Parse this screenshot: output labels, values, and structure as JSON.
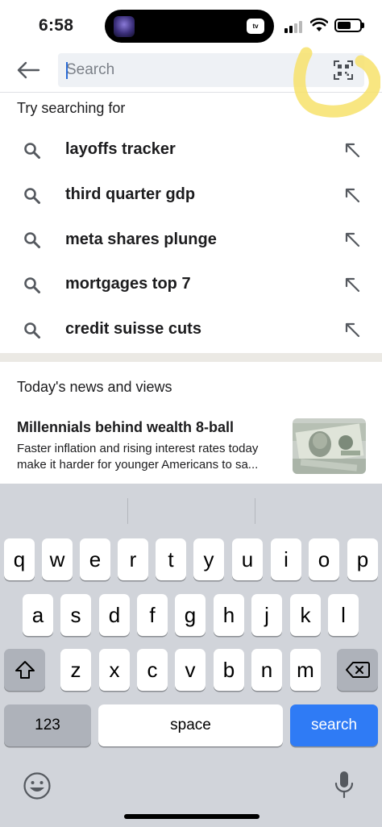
{
  "status_bar": {
    "time": "6:58",
    "island_badge": "tv"
  },
  "search": {
    "placeholder": "Search",
    "value": ""
  },
  "suggestions_title": "Try searching for",
  "suggestions": [
    {
      "label": "layoffs tracker"
    },
    {
      "label": "third quarter gdp"
    },
    {
      "label": "meta shares plunge"
    },
    {
      "label": "mortgages top 7"
    },
    {
      "label": "credit suisse cuts"
    }
  ],
  "news_title": "Today's news and views",
  "news": [
    {
      "headline": "Millennials behind wealth 8-ball",
      "summary_line1": "Faster inflation and rising interest rates today",
      "summary_line2": "make it harder for younger Americans to sa..."
    }
  ],
  "keyboard": {
    "row1": [
      "q",
      "w",
      "e",
      "r",
      "t",
      "y",
      "u",
      "i",
      "o",
      "p"
    ],
    "row2": [
      "a",
      "s",
      "d",
      "f",
      "g",
      "h",
      "j",
      "k",
      "l"
    ],
    "row3": [
      "z",
      "x",
      "c",
      "v",
      "b",
      "n",
      "m"
    ],
    "numbers_key": "123",
    "space_key": "space",
    "search_key": "search"
  },
  "colors": {
    "accent": "#2f7bf5",
    "highlight": "#f7e26b",
    "search_bg": "#eef1f5"
  },
  "icons": {
    "back": "arrow-left-icon",
    "qr": "qr-scan-icon",
    "suggestion": "search-icon",
    "fill": "arrow-up-left-icon",
    "shift": "shift-icon",
    "delete": "backspace-icon",
    "emoji": "emoji-icon",
    "dictation": "microphone-icon"
  }
}
